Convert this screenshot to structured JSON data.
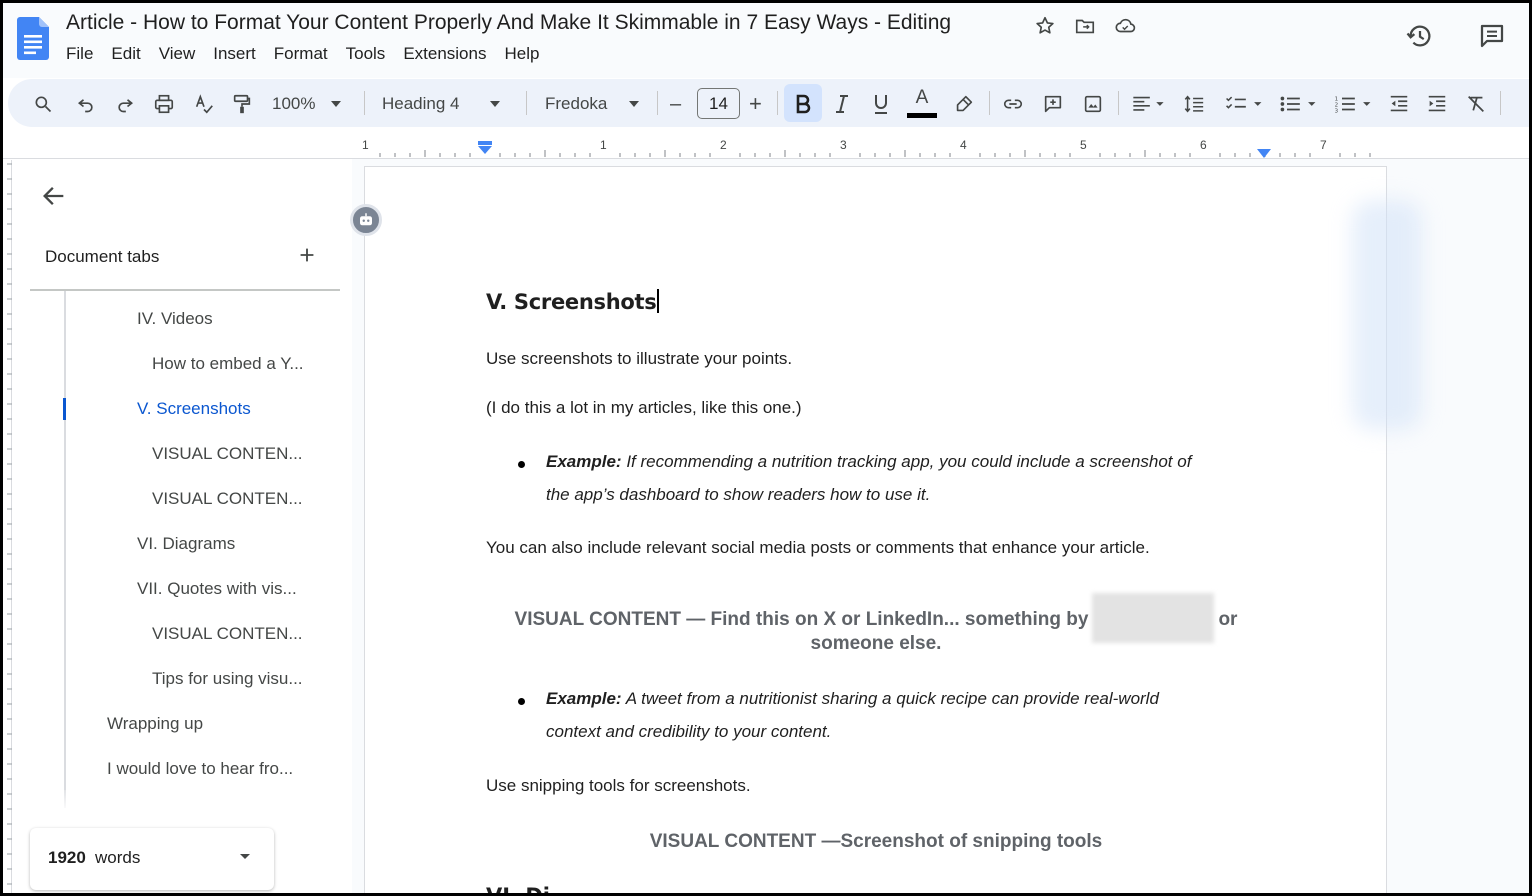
{
  "window": {
    "doc_title": "Article - How to Format Your Content Properly And Make It Skimmable in 7 Easy Ways - Editing"
  },
  "menu": [
    "File",
    "Edit",
    "View",
    "Insert",
    "Format",
    "Tools",
    "Extensions",
    "Help"
  ],
  "toolbar": {
    "zoom": "100%",
    "style": "Heading 4",
    "font": "Fredoka",
    "font_size": "14",
    "minus": "–",
    "plus": "+",
    "text_color_letter": "A"
  },
  "ruler": {
    "labels": [
      "1",
      "1",
      "2",
      "3",
      "4",
      "5",
      "6",
      "7"
    ]
  },
  "sidebar": {
    "heading": "Document tabs",
    "outline": [
      {
        "label": "IV. Videos",
        "level": 2,
        "active": false
      },
      {
        "label": "How to embed a Y...",
        "level": 3,
        "active": false
      },
      {
        "label": "V. Screenshots",
        "level": 2,
        "active": true
      },
      {
        "label": "VISUAL CONTEN...",
        "level": 3,
        "active": false
      },
      {
        "label": "VISUAL CONTEN...",
        "level": 3,
        "active": false
      },
      {
        "label": "VI. Diagrams",
        "level": 2,
        "active": false
      },
      {
        "label": "VII. Quotes with vis...",
        "level": 2,
        "active": false
      },
      {
        "label": "VISUAL CONTEN...",
        "level": 3,
        "active": false
      },
      {
        "label": "Tips for using visu...",
        "level": 3,
        "active": false
      },
      {
        "label": "Wrapping up",
        "level": 1,
        "active": false
      },
      {
        "label": "I would love to hear fro...",
        "level": 1,
        "active": false
      }
    ],
    "word_count": {
      "number": "1920",
      "label": "words"
    }
  },
  "document": {
    "heading": "V. Screenshots",
    "p1": "Use screenshots to illustrate your points.",
    "p2": "(I do this a lot in my articles, like this one.)",
    "example1_label": "Example:",
    "example1_line1": "If recommending a nutrition tracking app, you could include a screenshot of",
    "example1_line2": "the app’s dashboard to show readers how to use it.",
    "p3": "You can also include relevant social media posts or comments that enhance your article.",
    "visual1_line1_start": "VISUAL CONTENT — Find this on X or LinkedIn... something by",
    "visual1_line1_end": "or",
    "visual1_line2": "someone else.",
    "example2_label": "Example:",
    "example2_line1": "A tweet from a nutritionist sharing a quick recipe can provide real-world",
    "example2_line2": "context and credibility to your content.",
    "p4": "Use snipping tools for screenshots.",
    "visual2": "VISUAL CONTENT —Screenshot of snipping tools",
    "next_heading_partial": "VI. Di"
  },
  "colors": {
    "accent": "#0b57d0",
    "toolbar_bg": "#edf2fa",
    "active_button_bg": "#d3e3fd",
    "visual_content_text": "#5f6368"
  }
}
